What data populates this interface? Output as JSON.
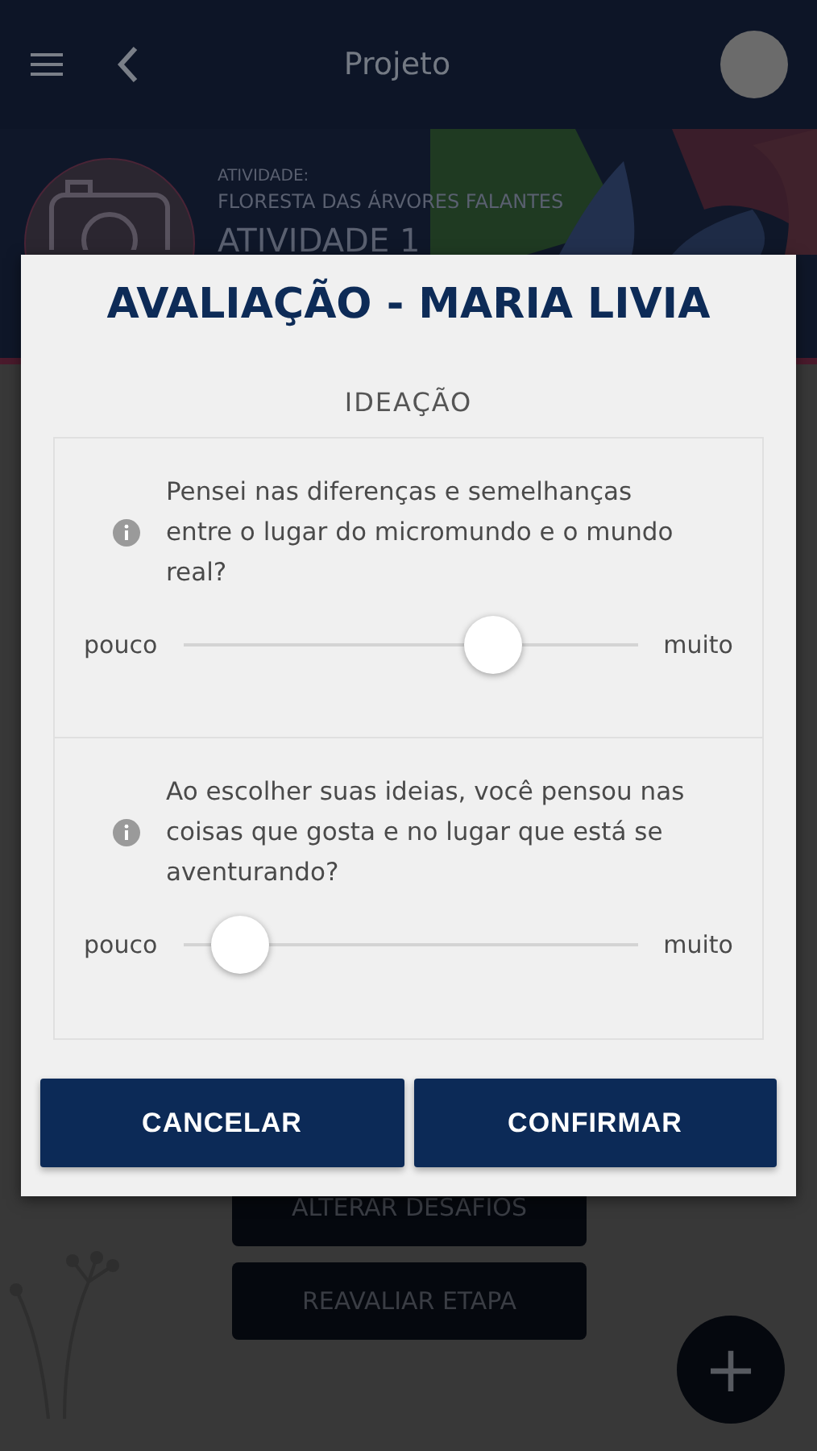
{
  "header": {
    "title": "Projeto"
  },
  "activity": {
    "label": "ATIVIDADE:",
    "name": "FLORESTA DAS ÁRVORES FALANTES",
    "title": "ATIVIDADE 1"
  },
  "page_buttons": [
    "ALTERAR DESAFIOS",
    "REAVALIAR ETAPA"
  ],
  "fab": {
    "label": "+"
  },
  "dialog": {
    "title": "AVALIAÇÃO - MARIA LIVIA",
    "section": "IDEAÇÃO",
    "questions": [
      {
        "text": "Pensei nas diferenças e semelhanças entre o lugar do micromundo e o mundo real?",
        "min_label": "pouco",
        "max_label": "muito",
        "level": 0.71
      },
      {
        "text": "Ao escolher suas ideias, você pensou nas coisas que gosta e no lugar que está se aventurando?",
        "min_label": "pouco",
        "max_label": "muito",
        "level": 0.07
      }
    ],
    "buttons": [
      "CANCELAR",
      "CONFIRMAR"
    ]
  }
}
